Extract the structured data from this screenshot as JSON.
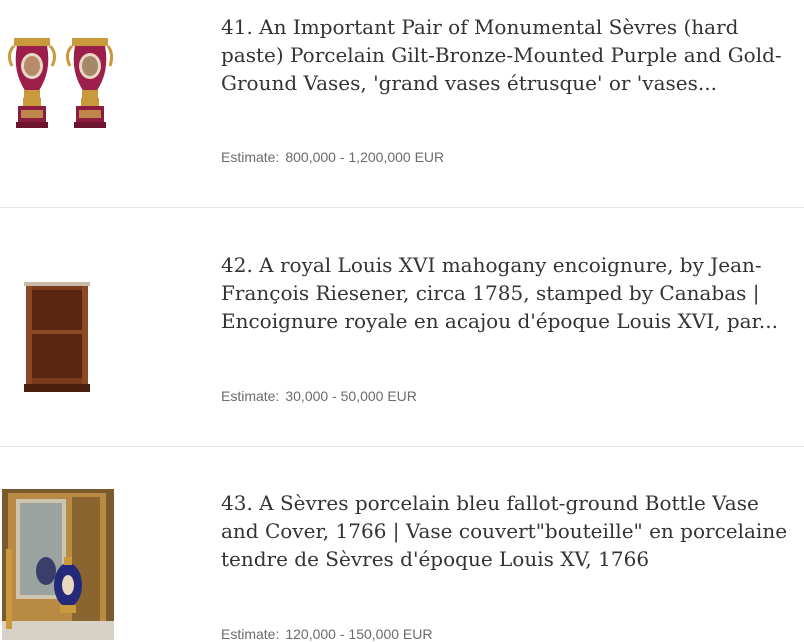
{
  "lots": [
    {
      "title": "41. An Important Pair of Monumental Sèvres (hard paste) Porcelain Gilt-Bronze-Mounted Purple and Gold-Ground Vases, 'grand vases étrusque' or 'vases...",
      "estimate_label": "Estimate:",
      "estimate_value": "800,000 - 1,200,000 EUR"
    },
    {
      "title": "42. A royal Louis XVI mahogany encoignure, by Jean-François Riesener, circa 1785, stamped by Canabas | Encoignure royale en acajou d'époque Louis XVI, par...",
      "estimate_label": "Estimate:",
      "estimate_value": "30,000 - 50,000 EUR"
    },
    {
      "title": "43. A Sèvres porcelain bleu fallot-ground Bottle Vase and Cover, 1766 | Vase couvert\"bouteille\" en porcelaine tendre de Sèvres d'époque Louis XV, 1766",
      "estimate_label": "Estimate:",
      "estimate_value": "120,000 - 150,000 EUR"
    }
  ],
  "colors": {
    "title_text": "#333333",
    "estimate_text": "#6b6b6b",
    "divider": "#e6e6e6",
    "vase_ground": "#9b1f4a",
    "gilt": "#c99a3c",
    "mahogany": "#7a3a1c",
    "cobalt": "#232a7a"
  }
}
